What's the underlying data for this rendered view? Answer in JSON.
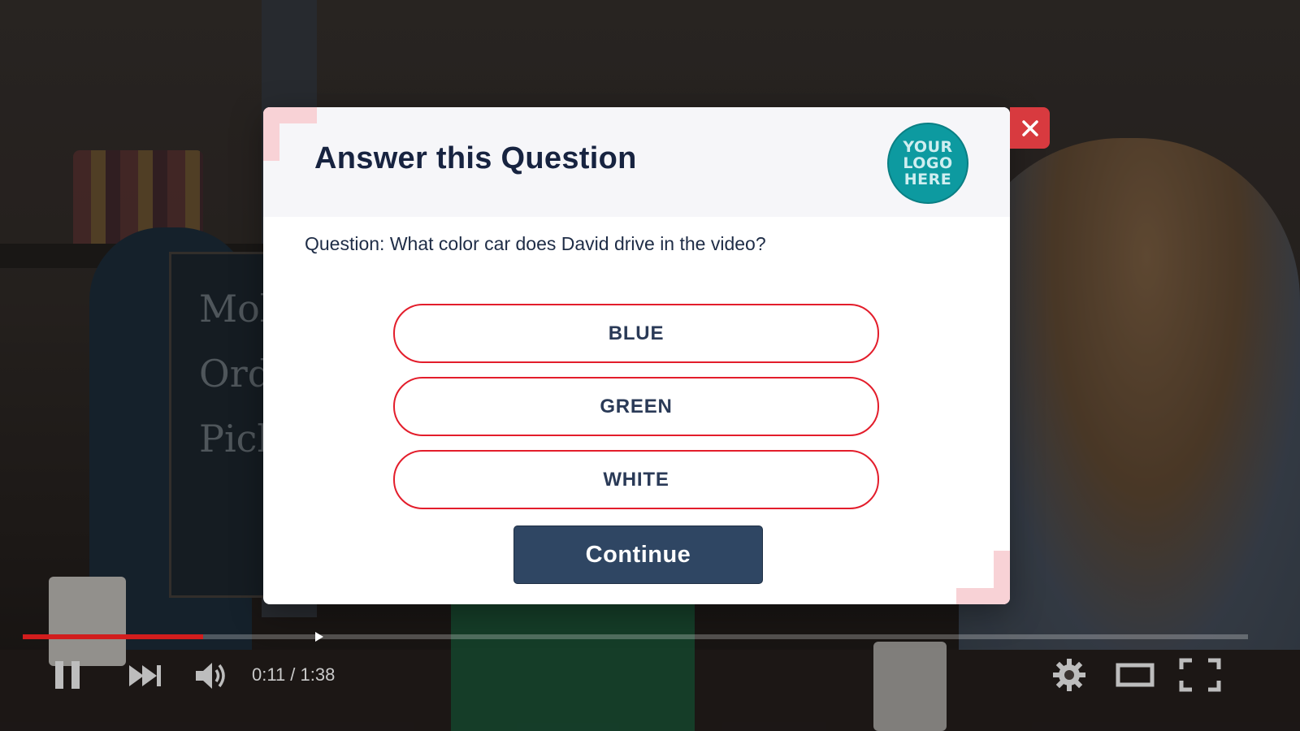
{
  "modal": {
    "title": "Answer this Question",
    "logo_text": "YOUR\nLOGO\nHERE",
    "question": "Question: What color car does David drive in the video?",
    "options": [
      {
        "label": "BLUE"
      },
      {
        "label": "GREEN"
      },
      {
        "label": "WHITE"
      }
    ],
    "continue_label": "Continue",
    "close_icon": "close-icon"
  },
  "player": {
    "current_time": "0:11",
    "separator": "/",
    "duration": "1:38",
    "time_display": "0:11 / 1:38",
    "progress_fraction": 0.147,
    "controls": [
      "pause-icon",
      "next-icon",
      "volume-icon",
      "settings-icon",
      "theater-mode-icon",
      "fullscreen-icon"
    ]
  },
  "background": {
    "chalkboard_text": "Mob\nOrd\nPick-"
  },
  "colors": {
    "accent_red": "#e31d2b",
    "continue_bg": "#2f4663",
    "title_color": "#172340",
    "logo_teal": "#0d9aa0",
    "close_bg": "#d83a3f",
    "progress_red": "#d21d1d"
  }
}
